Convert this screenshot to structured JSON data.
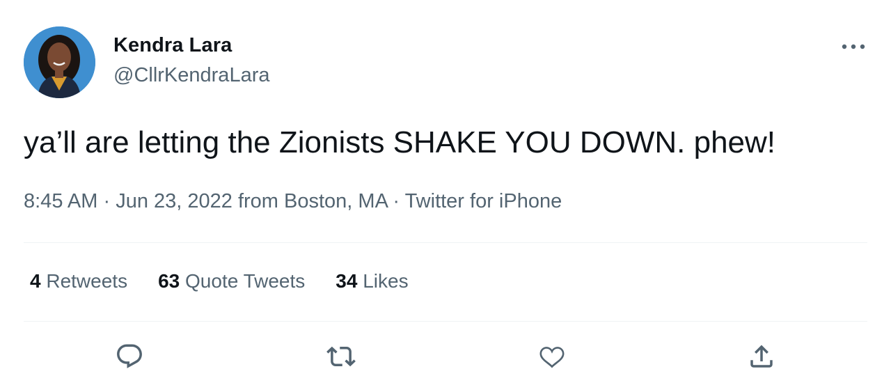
{
  "author": {
    "display_name": "Kendra Lara",
    "handle": "@CllrKendraLara",
    "avatar_icon": "profile-photo"
  },
  "tweet": {
    "text": "ya’ll are letting the Zionists SHAKE YOU DOWN. phew!",
    "time": "8:45 AM",
    "separator": " · ",
    "date": "Jun 23, 2022",
    "location": "from Boston, MA",
    "source": "Twitter for iPhone"
  },
  "stats": {
    "retweets": {
      "count": "4",
      "label": "Retweets"
    },
    "quote_tweets": {
      "count": "63",
      "label": "Quote Tweets"
    },
    "likes": {
      "count": "34",
      "label": "Likes"
    }
  },
  "actions": {
    "reply_icon": "reply-icon",
    "retweet_icon": "retweet-icon",
    "like_icon": "heart-icon",
    "share_icon": "share-icon",
    "more_icon": "more-dots-icon"
  },
  "colors": {
    "primary_text": "#0f1419",
    "secondary_text": "#536471",
    "divider": "#eff3f4",
    "icon": "#536471"
  }
}
